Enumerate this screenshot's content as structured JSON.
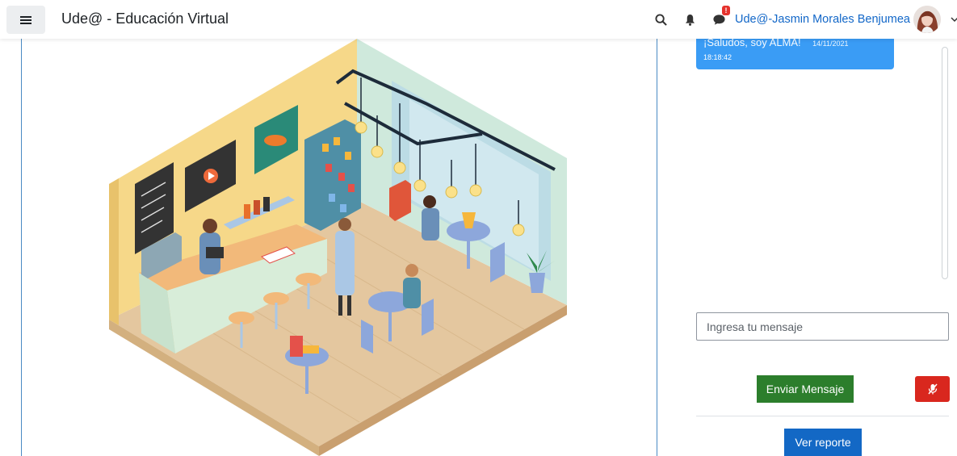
{
  "navbar": {
    "menu_icon": "hamburger-icon",
    "site_title": "Ude@ - Educación Virtual",
    "search_icon": "search-icon",
    "notifications_icon": "bell-icon",
    "messages_icon": "speech-bubble-icon",
    "messages_badge": "!",
    "user_name": "Ude@-Jasmin Morales Benjumea",
    "user_menu_icon": "chevron-down-icon"
  },
  "chat": {
    "messages": [
      {
        "text": "¡Saludos, soy ALMA!",
        "date": "14/11/2021",
        "time": "18:18:42"
      }
    ],
    "input_placeholder": "Ingresa tu mensaje",
    "send_label": "Enviar Mensaje",
    "mic_icon": "mic-off-icon",
    "report_label": "Ver reporte"
  },
  "colors": {
    "bubble": "#3a9cf5",
    "send": "#2c7e2c",
    "mic": "#d9271e",
    "report": "#1368c5",
    "link": "#1267c8"
  }
}
